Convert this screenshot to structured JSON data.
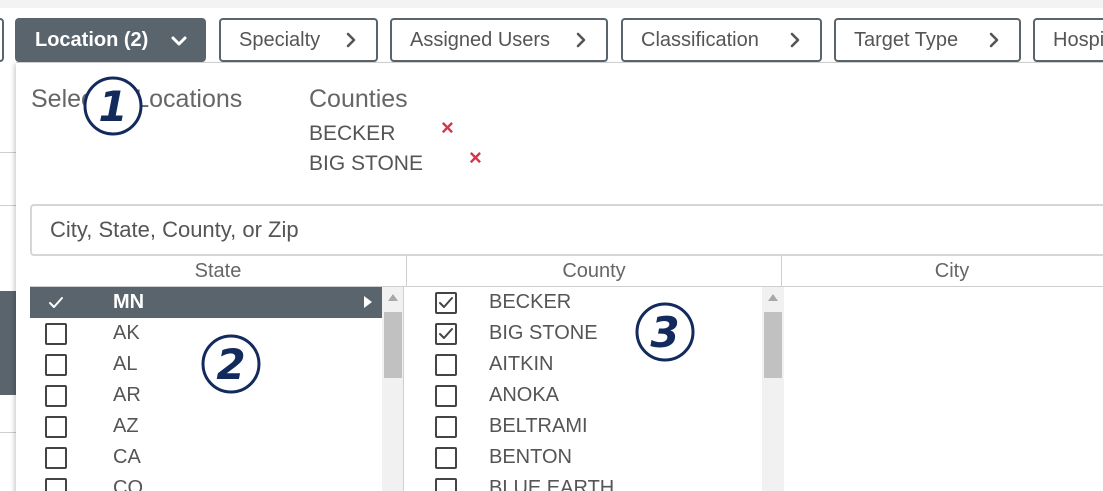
{
  "filters": [
    {
      "label": "Location (2)",
      "active": true
    },
    {
      "label": "Specialty",
      "active": false
    },
    {
      "label": "Assigned Users",
      "active": false
    },
    {
      "label": "Classification",
      "active": false
    },
    {
      "label": "Target Type",
      "active": false
    },
    {
      "label": "Hospi",
      "active": false
    }
  ],
  "panel": {
    "selected_heading": "Selected Locations",
    "counties_heading": "Counties",
    "selected_counties": [
      "BECKER",
      "BIG STONE"
    ],
    "remove_icon": "×",
    "search_placeholder": "City, State, County, or Zip",
    "columns": {
      "state": "State",
      "county": "County",
      "city": "City"
    },
    "states": [
      {
        "label": "MN",
        "checked": true,
        "selected": true
      },
      {
        "label": "AK",
        "checked": false
      },
      {
        "label": "AL",
        "checked": false
      },
      {
        "label": "AR",
        "checked": false
      },
      {
        "label": "AZ",
        "checked": false
      },
      {
        "label": "CA",
        "checked": false
      },
      {
        "label": "CO",
        "checked": false
      }
    ],
    "counties": [
      {
        "label": "BECKER",
        "checked": true
      },
      {
        "label": "BIG STONE",
        "checked": true
      },
      {
        "label": "AITKIN",
        "checked": false
      },
      {
        "label": "ANOKA",
        "checked": false
      },
      {
        "label": "BELTRAMI",
        "checked": false
      },
      {
        "label": "BENTON",
        "checked": false
      },
      {
        "label": "BLUE EARTH",
        "checked": false
      }
    ]
  },
  "annotations": [
    {
      "number": "1"
    },
    {
      "number": "2"
    },
    {
      "number": "3"
    }
  ],
  "colors": {
    "active_bg": "#5a646c",
    "remove_red": "#d9334a",
    "badge_navy": "#132a5c"
  }
}
